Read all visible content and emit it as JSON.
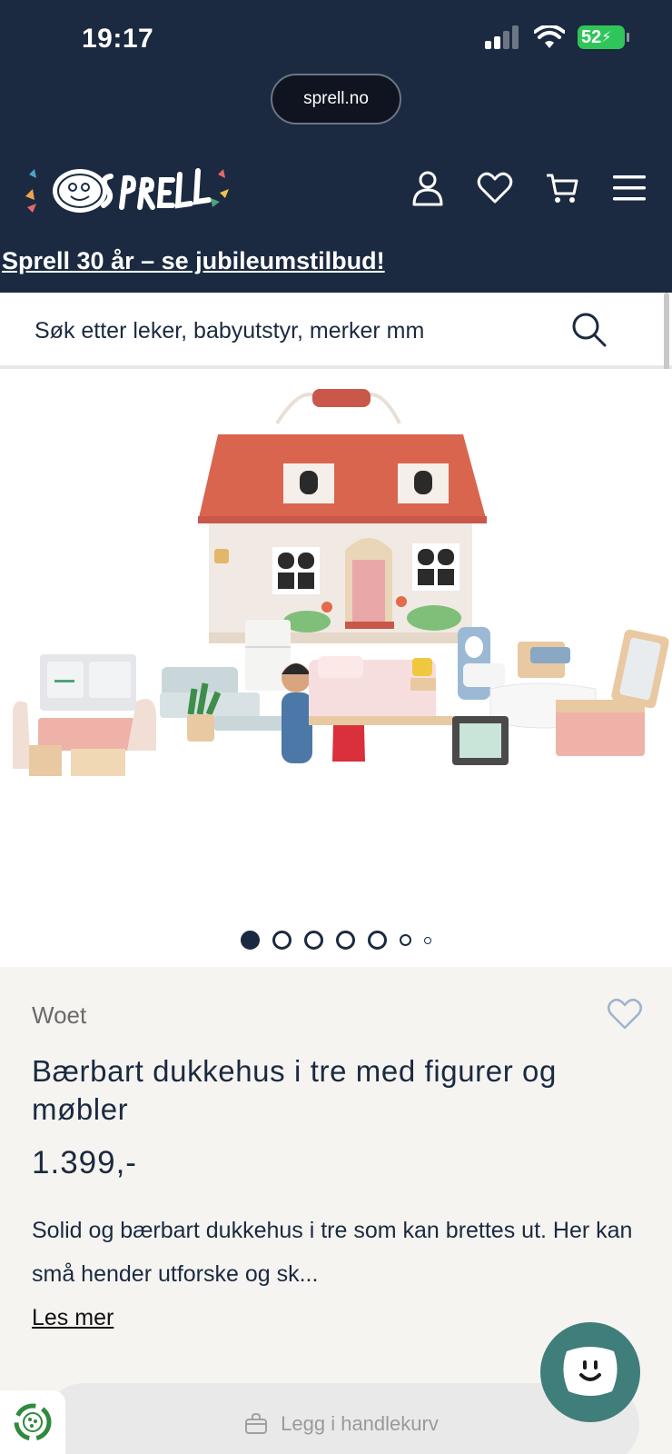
{
  "status": {
    "time": "19:17",
    "battery": "52"
  },
  "browser": {
    "url": "sprell.no"
  },
  "header": {
    "promo": "Sprell 30 år – se jubileumstilbud!"
  },
  "search": {
    "placeholder": "Søk etter leker, babyutstyr, merker mm"
  },
  "gallery": {
    "slide_count": 7,
    "active_index": 0
  },
  "product": {
    "brand": "Woet",
    "title": "Bærbart dukkehus i tre med figurer og møbler",
    "price": "1.399,-",
    "description": "Solid og bærbart dukkehus i tre som kan brettes ut. Her kan små hender utforske og sk...",
    "read_more": "Les mer"
  },
  "actions": {
    "add_to_cart": "Legg i handlekurv"
  },
  "colors": {
    "header_bg": "#1b2a40",
    "chat_bg": "#3f7e7a",
    "roof": "#d9654f"
  }
}
